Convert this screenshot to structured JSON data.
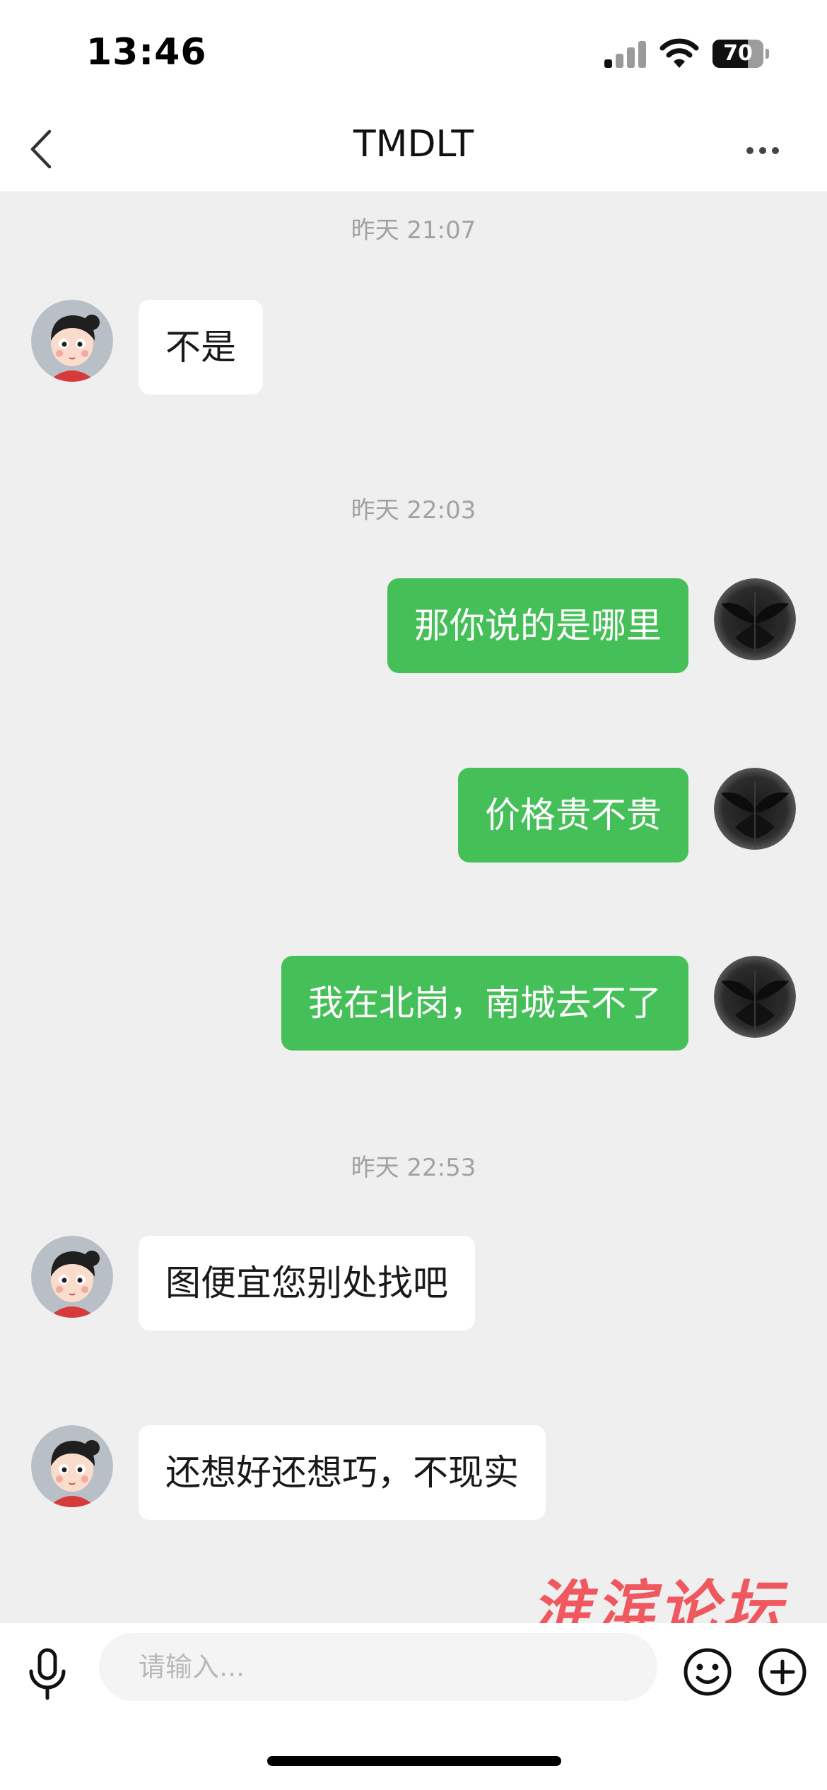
{
  "status_bar": {
    "time": "13:46",
    "battery_level": "70",
    "battery_fraction": 0.7,
    "icons": [
      "signal-icon",
      "wifi-icon",
      "battery-icon"
    ]
  },
  "nav": {
    "title": "TMDLT",
    "back_icon": "chevron-left-icon",
    "more_icon": "more-dots-icon"
  },
  "messages": [
    {
      "type": "time",
      "text": "昨天 21:07"
    },
    {
      "type": "incoming",
      "text": "不是"
    },
    {
      "type": "time",
      "text": "昨天 22:03"
    },
    {
      "type": "outgoing",
      "text": "那你说的是哪里"
    },
    {
      "type": "outgoing",
      "text": "价格贵不贵"
    },
    {
      "type": "outgoing",
      "text": "我在北岗，南城去不了"
    },
    {
      "type": "time",
      "text": "昨天 22:53"
    },
    {
      "type": "incoming",
      "text": "图便宜您别处找吧"
    },
    {
      "type": "incoming",
      "text": "还想好还想巧，不现实"
    }
  ],
  "watermark": "淮滨论坛",
  "input_bar": {
    "placeholder": "请输入...",
    "icons": [
      "microphone-icon",
      "emoji-icon",
      "plus-icon"
    ]
  },
  "colors": {
    "outgoing_bubble": "#45bf57",
    "incoming_bubble": "#ffffff",
    "background": "#efefef",
    "watermark": "#f04c52"
  }
}
